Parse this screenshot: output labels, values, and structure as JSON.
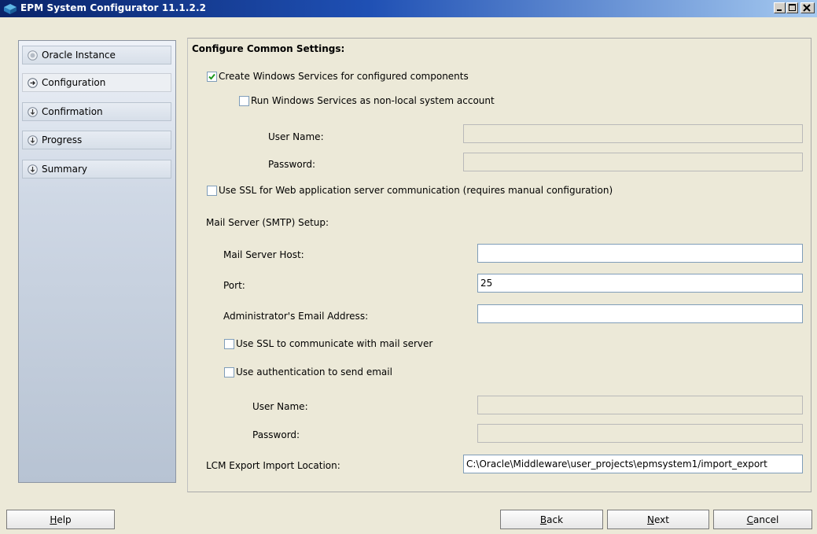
{
  "window": {
    "title": "EPM System Configurator 11.1.2.2",
    "controls": [
      "minimize-icon",
      "maximize-icon",
      "close-icon"
    ]
  },
  "nav": {
    "items": [
      {
        "label": "Oracle Instance",
        "icon": "completed-step-icon",
        "state": "done"
      },
      {
        "label": "Configuration",
        "icon": "current-step-icon",
        "state": "current"
      },
      {
        "label": "Confirmation",
        "icon": "pending-step-icon",
        "state": "pending"
      },
      {
        "label": "Progress",
        "icon": "pending-step-icon",
        "state": "pending"
      },
      {
        "label": "Summary",
        "icon": "pending-step-icon",
        "state": "pending"
      }
    ]
  },
  "main": {
    "section_title": "Configure Common Settings:",
    "create_services": {
      "label": "Create Windows Services for configured components",
      "checked": true
    },
    "run_nonlocal": {
      "label": "Run Windows Services as non-local system account",
      "checked": false
    },
    "svc_user_label": "User Name:",
    "svc_user_value": "",
    "svc_password_label": "Password:",
    "svc_password_value": "",
    "use_ssl_web": {
      "label": "Use SSL for Web application server communication (requires manual configuration)",
      "checked": false
    },
    "mail_setup_label": "Mail Server (SMTP) Setup:",
    "mail_host_label": "Mail Server Host:",
    "mail_host_value": "",
    "port_label": "Port:",
    "port_value": "25",
    "admin_email_label": "Administrator's Email Address:",
    "admin_email_value": "",
    "use_ssl_mail": {
      "label": "Use SSL to communicate with mail server",
      "checked": false
    },
    "use_auth": {
      "label": "Use authentication to send email",
      "checked": false
    },
    "mail_user_label": "User Name:",
    "mail_user_value": "",
    "mail_password_label": "Password:",
    "mail_password_value": "",
    "lcm_label": "LCM Export Import Location:",
    "lcm_value": "C:\\Oracle\\Middleware\\user_projects\\epmsystem1/import_export"
  },
  "buttons": {
    "help": {
      "pre": "",
      "mnemonic": "H",
      "post": "elp"
    },
    "back": {
      "pre": "",
      "mnemonic": "B",
      "post": "ack"
    },
    "next": {
      "pre": "",
      "mnemonic": "N",
      "post": "ext"
    },
    "cancel": {
      "pre": "",
      "mnemonic": "C",
      "post": "ancel"
    }
  }
}
